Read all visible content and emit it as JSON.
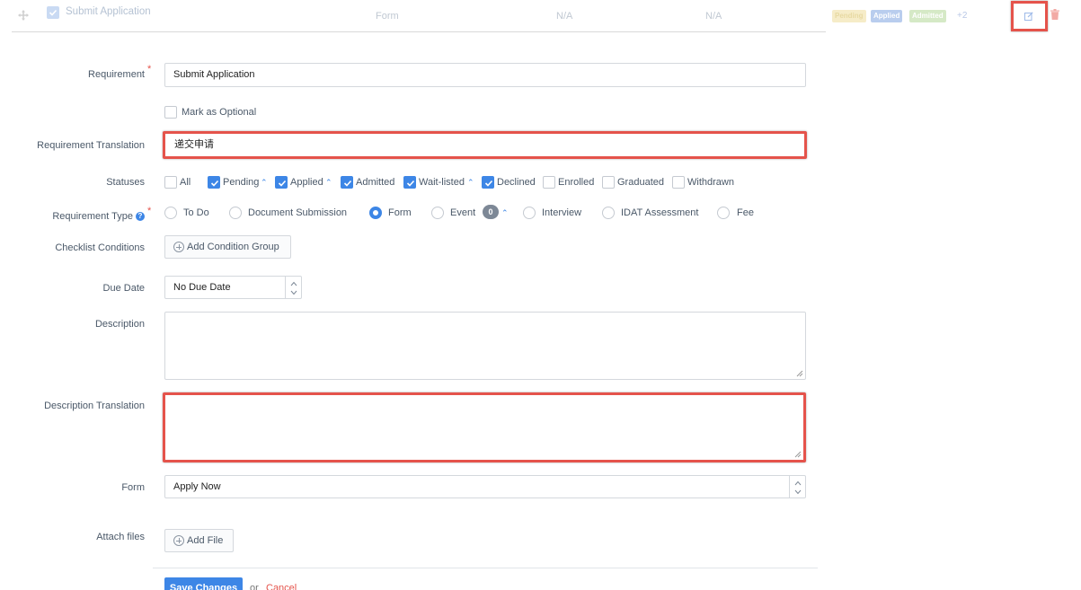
{
  "top_row": {
    "title": "Submit Application",
    "type": "Form",
    "col2": "N/A",
    "col3": "N/A",
    "badges": [
      "Pending",
      "Applied",
      "Admitted"
    ],
    "more_count": "+2"
  },
  "form": {
    "requirement": {
      "label": "Requirement",
      "value": "Submit Application"
    },
    "optional": {
      "label": "Mark as Optional"
    },
    "translation": {
      "label": "Requirement Translation",
      "value": "递交申请"
    },
    "statuses": {
      "label": "Statuses",
      "items": [
        {
          "label": "All",
          "checked": false
        },
        {
          "label": "Pending",
          "checked": true
        },
        {
          "label": "Applied",
          "checked": true
        },
        {
          "label": "Admitted",
          "checked": true
        },
        {
          "label": "Wait-listed",
          "checked": true
        },
        {
          "label": "Declined",
          "checked": true
        },
        {
          "label": "Enrolled",
          "checked": false
        },
        {
          "label": "Graduated",
          "checked": false
        },
        {
          "label": "Withdrawn",
          "checked": false
        }
      ]
    },
    "requirement_type": {
      "label": "Requirement Type",
      "options": [
        "To Do",
        "Document Submission",
        "Form",
        "Event",
        "Interview",
        "IDAT Assessment",
        "Fee"
      ],
      "selected": "Form",
      "event_count": "0"
    },
    "checklist": {
      "label": "Checklist Conditions",
      "button": "Add Condition Group"
    },
    "due_date": {
      "label": "Due Date",
      "value": "No Due Date"
    },
    "description": {
      "label": "Description",
      "value": ""
    },
    "description_translation": {
      "label": "Description Translation",
      "value": ""
    },
    "form_select": {
      "label": "Form",
      "value": "Apply Now"
    },
    "attach": {
      "label": "Attach files",
      "button": "Add File"
    }
  },
  "footer": {
    "save": "Save Changes",
    "or": "or",
    "cancel": "Cancel"
  },
  "colors": {
    "accent": "#3d86e6",
    "highlight": "#e5534b",
    "required": "#e5534b"
  }
}
